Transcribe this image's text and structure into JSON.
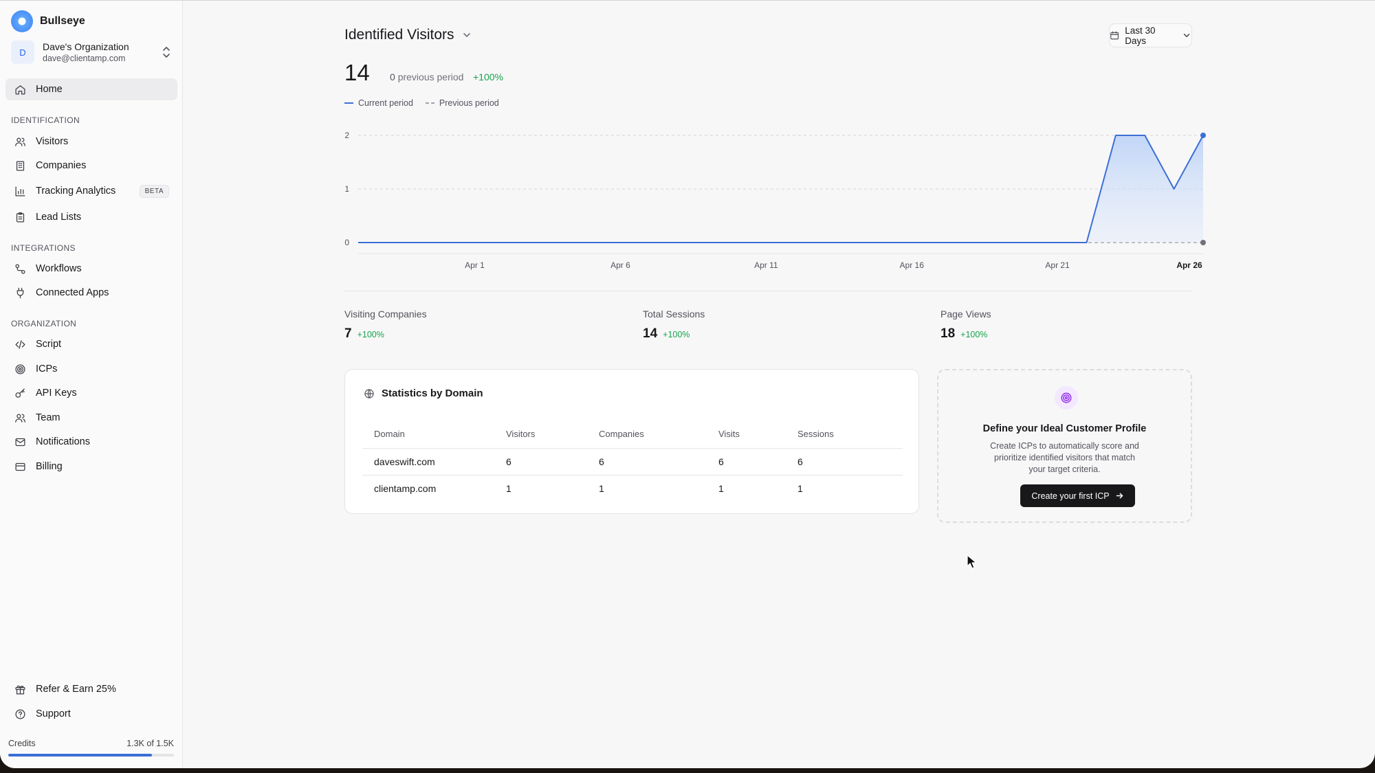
{
  "sidebar": {
    "brand": "Bullseye",
    "org": {
      "initial": "D",
      "name": "Dave's Organization",
      "email": "dave@clientamp.com"
    },
    "home": "Home",
    "sections": {
      "identification": "IDENTIFICATION",
      "integrations": "INTEGRATIONS",
      "organization": "ORGANIZATION"
    },
    "items": {
      "visitors": "Visitors",
      "companies": "Companies",
      "tracking": "Tracking Analytics",
      "tracking_badge": "BETA",
      "lead_lists": "Lead Lists",
      "workflows": "Workflows",
      "connected_apps": "Connected Apps",
      "script": "Script",
      "icps": "ICPs",
      "api_keys": "API Keys",
      "team": "Team",
      "notifications": "Notifications",
      "billing": "Billing",
      "refer": "Refer & Earn 25%",
      "support": "Support"
    },
    "credits": {
      "label": "Credits",
      "value": "1.3K of 1.5K",
      "fraction": 0.867
    }
  },
  "header": {
    "title": "Identified Visitors",
    "date_range": "Last 30 Days"
  },
  "summary": {
    "count": "14",
    "previous_value": "0",
    "previous_label": "previous period",
    "change": "+100%"
  },
  "legend": {
    "current": "Current period",
    "previous": "Previous period"
  },
  "chart_data": {
    "type": "area",
    "x_tick_labels": [
      "Apr 1",
      "Apr 6",
      "Apr 11",
      "Apr 16",
      "Apr 21",
      "Apr 26"
    ],
    "x": [
      "Mar 28",
      "Mar 29",
      "Mar 30",
      "Mar 31",
      "Apr 1",
      "Apr 2",
      "Apr 3",
      "Apr 4",
      "Apr 5",
      "Apr 6",
      "Apr 7",
      "Apr 8",
      "Apr 9",
      "Apr 10",
      "Apr 11",
      "Apr 12",
      "Apr 13",
      "Apr 14",
      "Apr 15",
      "Apr 16",
      "Apr 17",
      "Apr 18",
      "Apr 19",
      "Apr 20",
      "Apr 21",
      "Apr 22",
      "Apr 23",
      "Apr 24",
      "Apr 25",
      "Apr 26"
    ],
    "series": [
      {
        "name": "Current period",
        "values": [
          0,
          0,
          0,
          0,
          0,
          0,
          0,
          0,
          0,
          0,
          0,
          0,
          0,
          0,
          0,
          0,
          0,
          0,
          0,
          0,
          0,
          0,
          0,
          0,
          0,
          0,
          2,
          2,
          1,
          2
        ],
        "color": "#3b6fd6"
      },
      {
        "name": "Previous period",
        "values": [
          0,
          0,
          0,
          0,
          0,
          0,
          0,
          0,
          0,
          0,
          0,
          0,
          0,
          0,
          0,
          0,
          0,
          0,
          0,
          0,
          0,
          0,
          0,
          0,
          0,
          0,
          0,
          0,
          0,
          0
        ],
        "color": "#a1a1aa"
      }
    ],
    "y_ticks": [
      0,
      1,
      2
    ],
    "ylim": [
      0,
      2
    ],
    "grid": true
  },
  "stats": [
    {
      "label": "Visiting Companies",
      "value": "7",
      "change": "+100%"
    },
    {
      "label": "Total Sessions",
      "value": "14",
      "change": "+100%"
    },
    {
      "label": "Page Views",
      "value": "18",
      "change": "+100%"
    }
  ],
  "domain_table": {
    "title": "Statistics by Domain",
    "columns": [
      "Domain",
      "Visitors",
      "Companies",
      "Visits",
      "Sessions"
    ],
    "rows": [
      [
        "daveswift.com",
        "6",
        "6",
        "6",
        "6"
      ],
      [
        "clientamp.com",
        "1",
        "1",
        "1",
        "1"
      ]
    ]
  },
  "icp": {
    "title": "Define your Ideal Customer Profile",
    "description": "Create ICPs to automatically score and prioritize identified visitors that match your target criteria.",
    "button": "Create your first ICP"
  }
}
